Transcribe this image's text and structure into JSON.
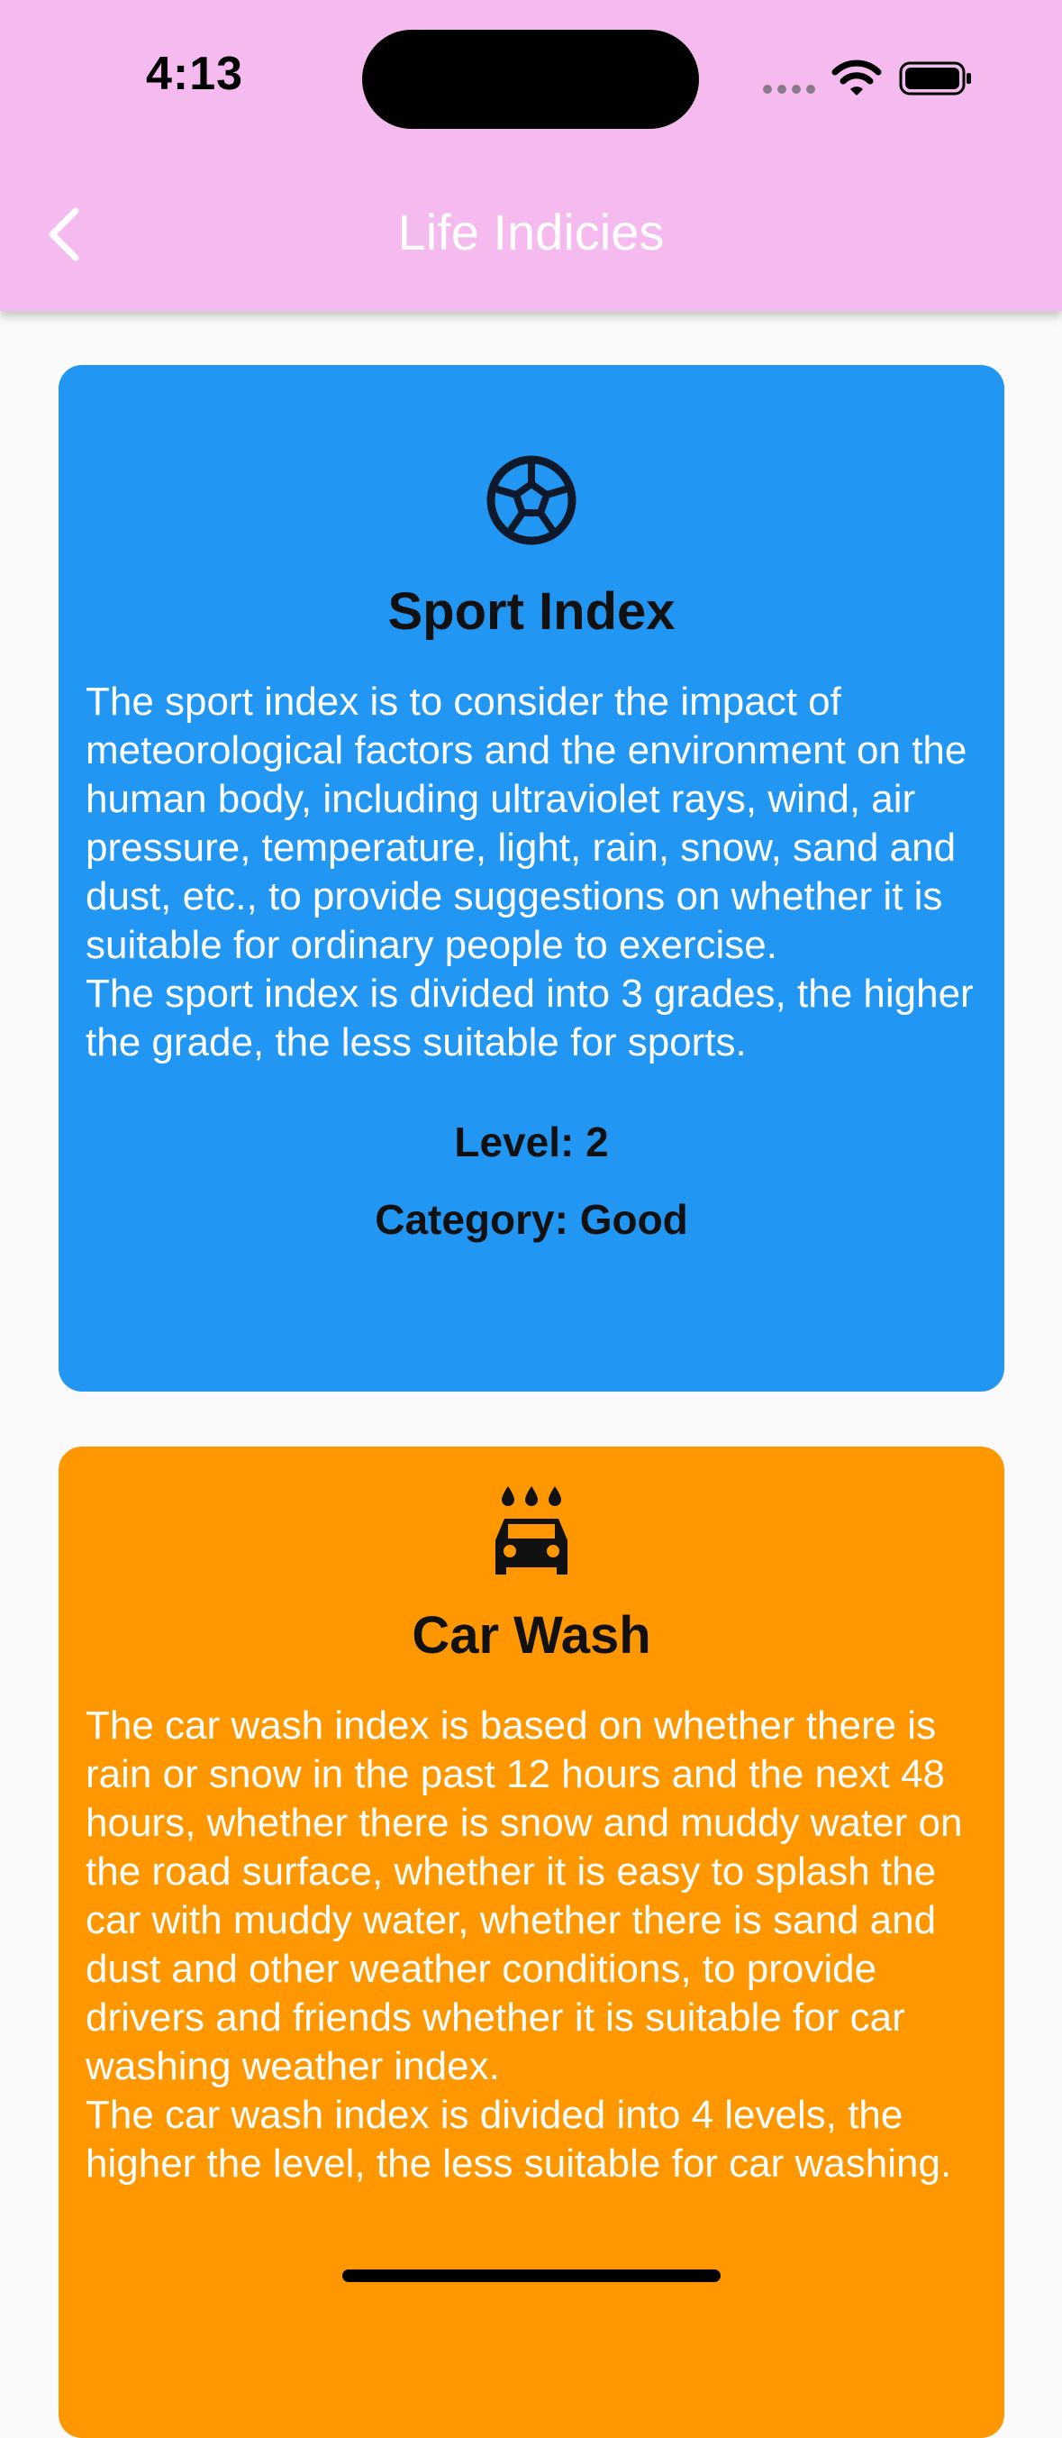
{
  "status_bar": {
    "time": "4:13"
  },
  "app_bar": {
    "title": "Life Indicies",
    "back_icon": "chevron-left-icon",
    "background_color": "#f5bbee"
  },
  "cards": [
    {
      "icon": "soccer-ball-icon",
      "title": "Sport Index",
      "description": "The sport index is to consider the impact of meteorological factors and the environment on the human body, including ultraviolet rays, wind, air pressure, temperature, light, rain, snow, sand and dust, etc., to provide suggestions on whether it is suitable for ordinary people to exercise.\nThe sport index is divided into 3 grades, the higher the grade, the less suitable for sports.",
      "level": "Level: 2",
      "category": "Category: Good",
      "background_color": "#2196f3"
    },
    {
      "icon": "car-wash-icon",
      "title": "Car Wash",
      "description": "The car wash index is based on whether there is rain or snow in the past 12 hours and the next 48 hours, whether there is snow and muddy water on the road surface, whether it is easy to splash the car with muddy water, whether there is sand and dust and other weather conditions, to provide drivers and friends whether it is suitable for car washing weather index.\nThe car wash index is divided into 4 levels, the higher the level, the less suitable for car washing.",
      "background_color": "#ff9800"
    }
  ]
}
